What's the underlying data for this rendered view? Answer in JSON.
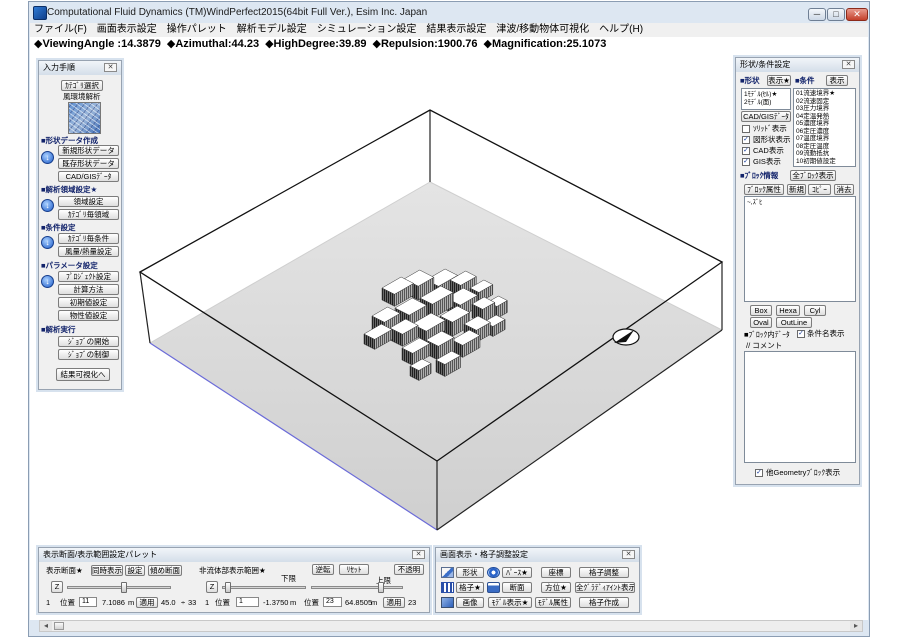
{
  "window": {
    "title": "Computational Fluid Dynamics (TM)WindPerfect2015(64bit Full Ver.), Esim Inc. Japan",
    "icons": [
      "app-icon",
      "minimize-icon",
      "maximize-icon",
      "close-icon"
    ]
  },
  "menu": {
    "items": [
      "ファイル(F)",
      "画面表示設定",
      "操作パレット",
      "解析モデル設定",
      "シミュレーション設定",
      "結果表示設定",
      "津波/移動物体可視化",
      "ヘルプ(H)"
    ]
  },
  "status": {
    "viewing_angle": "◆ViewingAngle :14.3879",
    "azimuthal": "◆Azimuthal:44.23",
    "high_degree": "◆HighDegree:39.89",
    "repulsion": "◆Repulsion:1900.76",
    "magnification": "◆Magnification:25.1073"
  },
  "left_panel": {
    "title": "入力手順",
    "category_button": "ｶﾃｺﾞﾘ選択",
    "analysis_type": "風環境解析",
    "sections": [
      {
        "title": "■形状データ作成",
        "buttons": [
          "新規形状データ",
          "既存形状データ",
          "CAD/GISﾃﾞｰﾀ"
        ]
      },
      {
        "title": "■解析領域設定★",
        "buttons": [
          "領域設定",
          "ｶﾃｺﾞﾘ毎領域"
        ]
      },
      {
        "title": "■条件設定",
        "buttons": [
          "ｶﾃｺﾞﾘ毎条件",
          "風量/熱量設定"
        ]
      },
      {
        "title": "■パラメータ設定",
        "buttons": [
          "ﾌﾟﾛｼﾞｪｸﾄ設定",
          "計算方法",
          "初期値設定",
          "物性値設定"
        ]
      },
      {
        "title": "■解析実行",
        "buttons": [
          "ｼﾞｮﾌﾞの開始",
          "ｼﾞｮﾌﾞの制御"
        ]
      }
    ],
    "result_button": "結果可視化へ"
  },
  "right_panel": {
    "title": "形状/条件設定",
    "shape_label": "■形状",
    "shape_button": "表示★",
    "condition_label": "■条件",
    "condition_button": "表示",
    "models": [
      "1ﾓﾃﾞﾙ(ｾﾙ)★",
      "2ﾓﾃﾞﾙ(面)"
    ],
    "conditions": [
      "01流速境界★",
      "02流速固定",
      "03圧力境界",
      "04定温発熱",
      "05濃度境界",
      "06定圧濃度",
      "07温度境界",
      "08定圧温度",
      "09流動抵抗",
      "10初期値設定"
    ],
    "cad_gis_button": "CAD/GISﾃﾞｰﾀ",
    "checkboxes": [
      {
        "label": "ｿﾘｯﾄﾞ表示",
        "checked": false
      },
      {
        "label": "図形状表示",
        "checked": true
      },
      {
        "label": "CAD表示",
        "checked": true
      },
      {
        "label": "GIS表示",
        "checked": true
      }
    ],
    "block_info_label": "■ﾌﾞﾛｯｸ情報",
    "all_blocks_button": "全ﾌﾞﾛｯｸ表示",
    "block_buttons": [
      "ﾌﾞﾛｯｸ属性",
      "新規",
      "ｺﾋﾟｰ",
      "消去"
    ],
    "block_list": [
      "~,ｽﾞﾋ"
    ],
    "shape_buttons": [
      "Box",
      "Hexa",
      "Cyl",
      "Oval",
      "OutLine"
    ],
    "block_data_label": "■ﾌﾞﾛｯｸ内ﾃﾞｰﾀ",
    "condition_name_checkbox": {
      "label": "条件名表示",
      "checked": true
    },
    "comment_label": "// コメント",
    "comment_value": "",
    "other_geometry_checkbox": {
      "label": "他Geometryﾌﾞﾛｯｸ表示",
      "checked": true
    }
  },
  "section_palette": {
    "title": "表示断面/表示範囲設定パレット",
    "section_label": "表示断面★",
    "simultaneous_button": "同時表示",
    "settings_button": "設定",
    "oblique_button": "傾め断面",
    "nonfluid_label": "非流体部表示範囲★",
    "lower_label": "下限",
    "upper_label": "上限",
    "reverse_button": "逆転",
    "reset_button": "ﾘｾｯﾄ",
    "opaque_button": "不透明",
    "axis_section": "Z",
    "axis_range": "Z",
    "slider_levels": {
      "section": 0.55,
      "lower": 0.04,
      "upper": 0.78
    },
    "row_section": {
      "index": "1",
      "pos_label": "位置",
      "pos": "11",
      "value": "7.1086",
      "unit": "m",
      "apply": "適用",
      "angle": "45.0",
      "divider": "÷",
      "count": "33"
    },
    "row_range": {
      "index": "1",
      "lower_pos_label": "位置",
      "lower_pos": "1",
      "lower_value": "-1.3750",
      "lower_unit": "m",
      "upper_pos_label": "位置",
      "upper_pos": "23",
      "upper_value": "64.8505",
      "upper_unit": "m",
      "apply": "適用",
      "count": "23"
    }
  },
  "display_palette": {
    "title": "画面表示・格子調整設定",
    "shape": "形状",
    "perspective": "ﾊﾟｰｽ★",
    "coordinates": "座標",
    "grid_adjust": "格子調整",
    "grid": "格子★",
    "section": "断面",
    "direction": "方位★",
    "all_gradient": "全ｸﾞﾗﾃﾞｨｱｲﾝﾄ表示★",
    "image": "画像",
    "model_display": "ﾓﾃﾞﾙ表示★",
    "model_attributes": "ﾓﾃﾞﾙ属性",
    "grid_create": "格子作成"
  },
  "colors": {
    "floor": "#d9d9d9",
    "floor_front_edge": "#6b6bd8",
    "step_icon": "#1d5cc9",
    "close_button": "#c3402b"
  }
}
